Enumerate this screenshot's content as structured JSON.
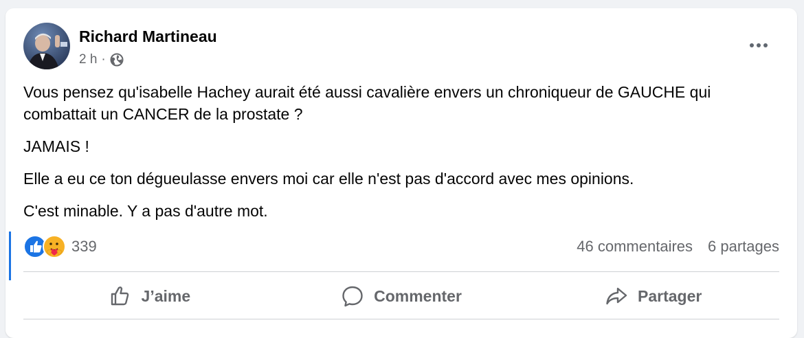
{
  "post": {
    "author": "Richard Martineau",
    "time": "2 h",
    "separator": "·",
    "paragraphs": [
      "Vous pensez qu'isabelle Hachey aurait été aussi cavalière envers un chroniqueur de GAUCHE qui combattait un CANCER de la prostate ?",
      "JAMAIS !",
      "Elle a eu ce ton dégueulasse envers moi car elle n'est pas d'accord avec mes opinions.",
      "C'est minable. Y a pas d'autre mot."
    ]
  },
  "reactions": {
    "count": "339",
    "icons": [
      "like-reaction-icon",
      "care-reaction-icon"
    ]
  },
  "stats": {
    "comments": "46 commentaires",
    "shares": "6 partages"
  },
  "actions": {
    "like": "J’aime",
    "comment": "Commenter",
    "share": "Partager"
  },
  "colors": {
    "accent": "#1b74e4",
    "secondary_text": "#65676b",
    "background": "#f0f2f5"
  }
}
